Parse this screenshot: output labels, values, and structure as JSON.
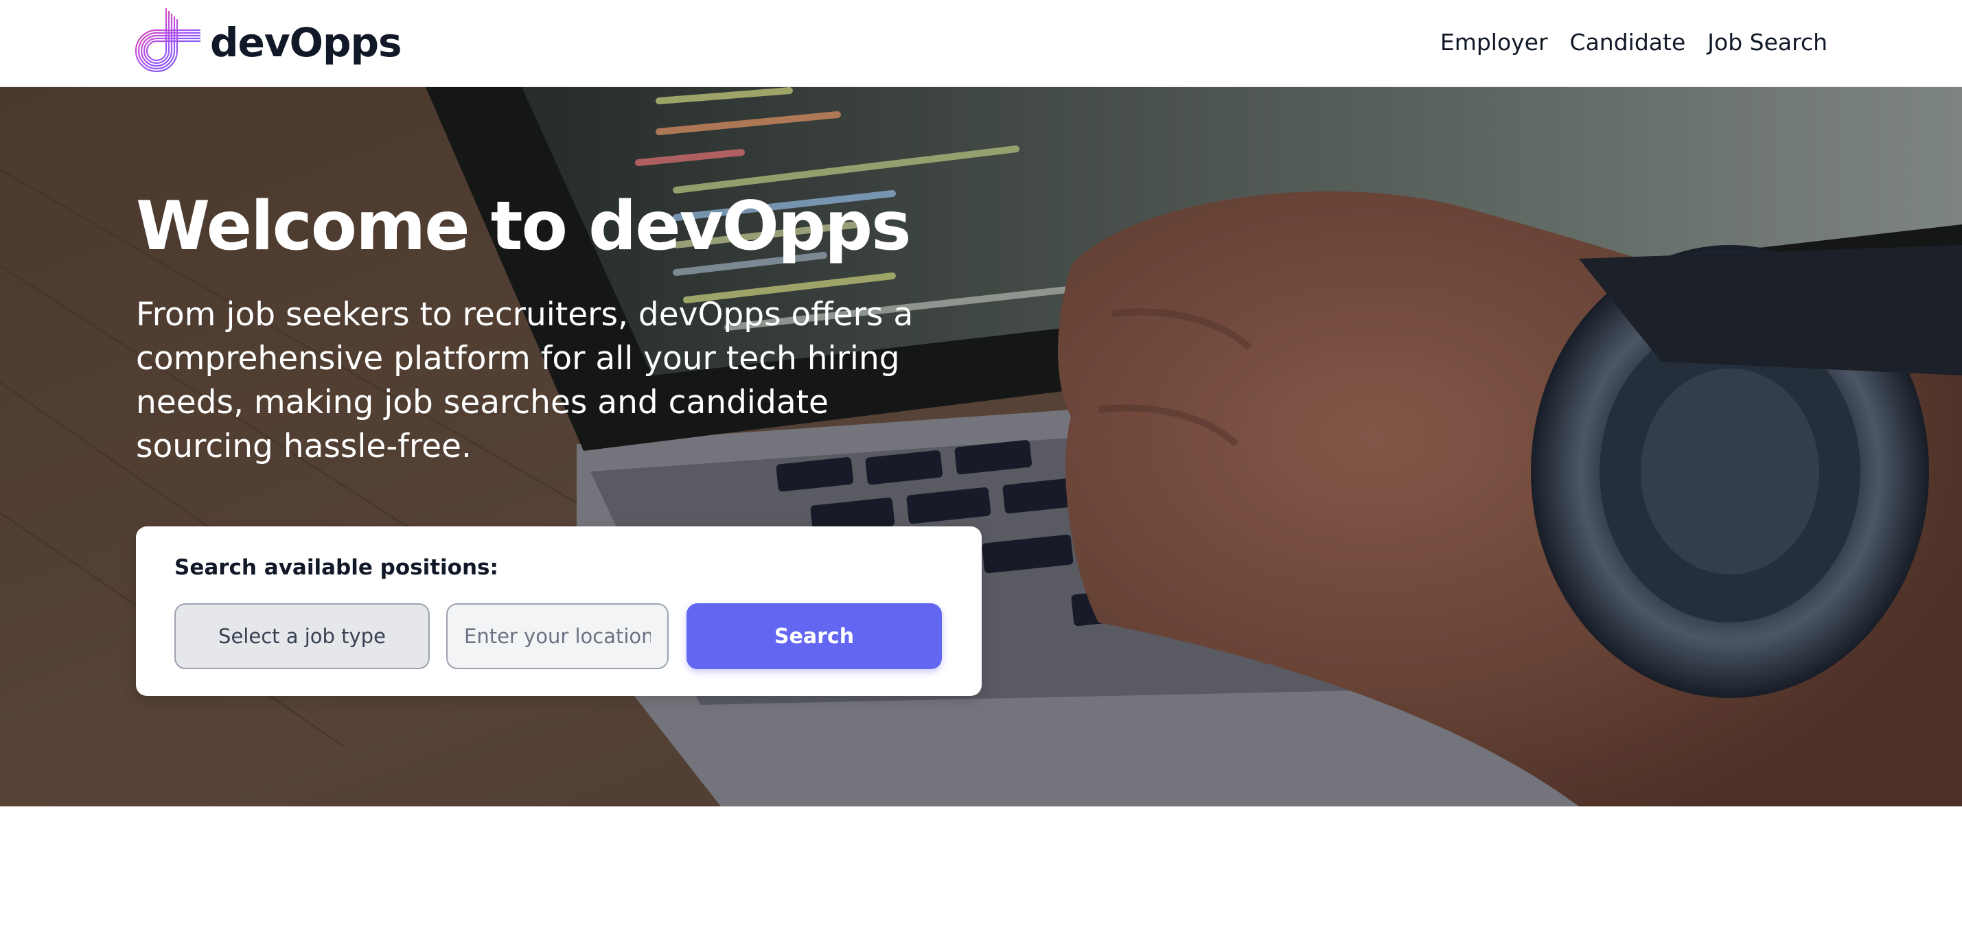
{
  "brand": {
    "name": "devOpps",
    "gradient_colors": [
      "#a855f7",
      "#6366f1",
      "#ec4899"
    ]
  },
  "nav": {
    "items": [
      {
        "label": "Employer",
        "icon": null
      },
      {
        "label": "Candidate",
        "icon": null
      },
      {
        "label": "Job Search",
        "icon": null
      }
    ]
  },
  "hero": {
    "title": "Welcome to devOpps",
    "subtitle": "From job seekers to recruiters, devOpps offers a comprehensive platform for all your tech hiring needs, making job searches and candidate sourcing hassle-free.",
    "background_image": "laptop-coding-photo"
  },
  "search": {
    "label": "Search available positions:",
    "job_type_value": "Select a job type",
    "location_value": "",
    "location_placeholder": "Enter your location",
    "button_label": "Search"
  },
  "colors": {
    "accent": "#6366f1",
    "text_dark": "#111827",
    "field_bg": "#e5e7eb"
  }
}
